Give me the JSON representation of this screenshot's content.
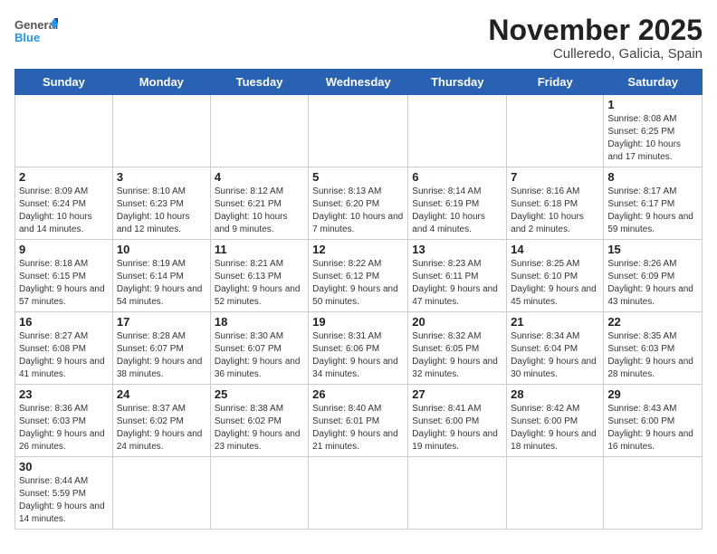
{
  "logo": {
    "general": "General",
    "blue": "Blue"
  },
  "title": "November 2025",
  "subtitle": "Culleredo, Galicia, Spain",
  "weekdays": [
    "Sunday",
    "Monday",
    "Tuesday",
    "Wednesday",
    "Thursday",
    "Friday",
    "Saturday"
  ],
  "weeks": [
    [
      {
        "day": "",
        "info": ""
      },
      {
        "day": "",
        "info": ""
      },
      {
        "day": "",
        "info": ""
      },
      {
        "day": "",
        "info": ""
      },
      {
        "day": "",
        "info": ""
      },
      {
        "day": "",
        "info": ""
      },
      {
        "day": "1",
        "info": "Sunrise: 8:08 AM\nSunset: 6:25 PM\nDaylight: 10 hours and 17 minutes."
      }
    ],
    [
      {
        "day": "2",
        "info": "Sunrise: 8:09 AM\nSunset: 6:24 PM\nDaylight: 10 hours and 14 minutes."
      },
      {
        "day": "3",
        "info": "Sunrise: 8:10 AM\nSunset: 6:23 PM\nDaylight: 10 hours and 12 minutes."
      },
      {
        "day": "4",
        "info": "Sunrise: 8:12 AM\nSunset: 6:21 PM\nDaylight: 10 hours and 9 minutes."
      },
      {
        "day": "5",
        "info": "Sunrise: 8:13 AM\nSunset: 6:20 PM\nDaylight: 10 hours and 7 minutes."
      },
      {
        "day": "6",
        "info": "Sunrise: 8:14 AM\nSunset: 6:19 PM\nDaylight: 10 hours and 4 minutes."
      },
      {
        "day": "7",
        "info": "Sunrise: 8:16 AM\nSunset: 6:18 PM\nDaylight: 10 hours and 2 minutes."
      },
      {
        "day": "8",
        "info": "Sunrise: 8:17 AM\nSunset: 6:17 PM\nDaylight: 9 hours and 59 minutes."
      }
    ],
    [
      {
        "day": "9",
        "info": "Sunrise: 8:18 AM\nSunset: 6:15 PM\nDaylight: 9 hours and 57 minutes."
      },
      {
        "day": "10",
        "info": "Sunrise: 8:19 AM\nSunset: 6:14 PM\nDaylight: 9 hours and 54 minutes."
      },
      {
        "day": "11",
        "info": "Sunrise: 8:21 AM\nSunset: 6:13 PM\nDaylight: 9 hours and 52 minutes."
      },
      {
        "day": "12",
        "info": "Sunrise: 8:22 AM\nSunset: 6:12 PM\nDaylight: 9 hours and 50 minutes."
      },
      {
        "day": "13",
        "info": "Sunrise: 8:23 AM\nSunset: 6:11 PM\nDaylight: 9 hours and 47 minutes."
      },
      {
        "day": "14",
        "info": "Sunrise: 8:25 AM\nSunset: 6:10 PM\nDaylight: 9 hours and 45 minutes."
      },
      {
        "day": "15",
        "info": "Sunrise: 8:26 AM\nSunset: 6:09 PM\nDaylight: 9 hours and 43 minutes."
      }
    ],
    [
      {
        "day": "16",
        "info": "Sunrise: 8:27 AM\nSunset: 6:08 PM\nDaylight: 9 hours and 41 minutes."
      },
      {
        "day": "17",
        "info": "Sunrise: 8:28 AM\nSunset: 6:07 PM\nDaylight: 9 hours and 38 minutes."
      },
      {
        "day": "18",
        "info": "Sunrise: 8:30 AM\nSunset: 6:07 PM\nDaylight: 9 hours and 36 minutes."
      },
      {
        "day": "19",
        "info": "Sunrise: 8:31 AM\nSunset: 6:06 PM\nDaylight: 9 hours and 34 minutes."
      },
      {
        "day": "20",
        "info": "Sunrise: 8:32 AM\nSunset: 6:05 PM\nDaylight: 9 hours and 32 minutes."
      },
      {
        "day": "21",
        "info": "Sunrise: 8:34 AM\nSunset: 6:04 PM\nDaylight: 9 hours and 30 minutes."
      },
      {
        "day": "22",
        "info": "Sunrise: 8:35 AM\nSunset: 6:03 PM\nDaylight: 9 hours and 28 minutes."
      }
    ],
    [
      {
        "day": "23",
        "info": "Sunrise: 8:36 AM\nSunset: 6:03 PM\nDaylight: 9 hours and 26 minutes."
      },
      {
        "day": "24",
        "info": "Sunrise: 8:37 AM\nSunset: 6:02 PM\nDaylight: 9 hours and 24 minutes."
      },
      {
        "day": "25",
        "info": "Sunrise: 8:38 AM\nSunset: 6:02 PM\nDaylight: 9 hours and 23 minutes."
      },
      {
        "day": "26",
        "info": "Sunrise: 8:40 AM\nSunset: 6:01 PM\nDaylight: 9 hours and 21 minutes."
      },
      {
        "day": "27",
        "info": "Sunrise: 8:41 AM\nSunset: 6:00 PM\nDaylight: 9 hours and 19 minutes."
      },
      {
        "day": "28",
        "info": "Sunrise: 8:42 AM\nSunset: 6:00 PM\nDaylight: 9 hours and 18 minutes."
      },
      {
        "day": "29",
        "info": "Sunrise: 8:43 AM\nSunset: 6:00 PM\nDaylight: 9 hours and 16 minutes."
      }
    ],
    [
      {
        "day": "30",
        "info": "Sunrise: 8:44 AM\nSunset: 5:59 PM\nDaylight: 9 hours and 14 minutes."
      },
      {
        "day": "",
        "info": ""
      },
      {
        "day": "",
        "info": ""
      },
      {
        "day": "",
        "info": ""
      },
      {
        "day": "",
        "info": ""
      },
      {
        "day": "",
        "info": ""
      },
      {
        "day": "",
        "info": ""
      }
    ]
  ]
}
